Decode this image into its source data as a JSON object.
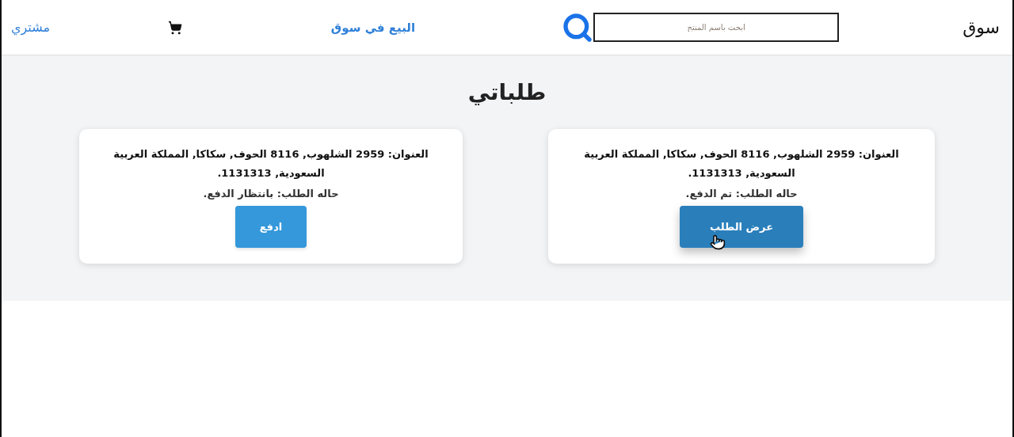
{
  "header": {
    "brand": "سوق",
    "search": {
      "placeholder": "ابحث باسم المنتج"
    },
    "sell_link": "البيع في سوق",
    "account_link": "مشتري"
  },
  "page_title": "طلباتي",
  "orders": [
    {
      "address": "العنوان: 2959 الشلهوب, 8116 الحوف, سكاكا, المملكة العربية السعودية, 1131313.",
      "status": "حاله الطلب: تم الدفع.",
      "button": "عرض الطلب",
      "hovered": true
    },
    {
      "address": "العنوان: 2959 الشلهوب, 8116 الحوف, سكاكا, المملكة العربية السعودية, 1131313.",
      "status": "حاله الطلب: بانتظار الدفع.",
      "button": "ادفع",
      "hovered": false
    }
  ]
}
